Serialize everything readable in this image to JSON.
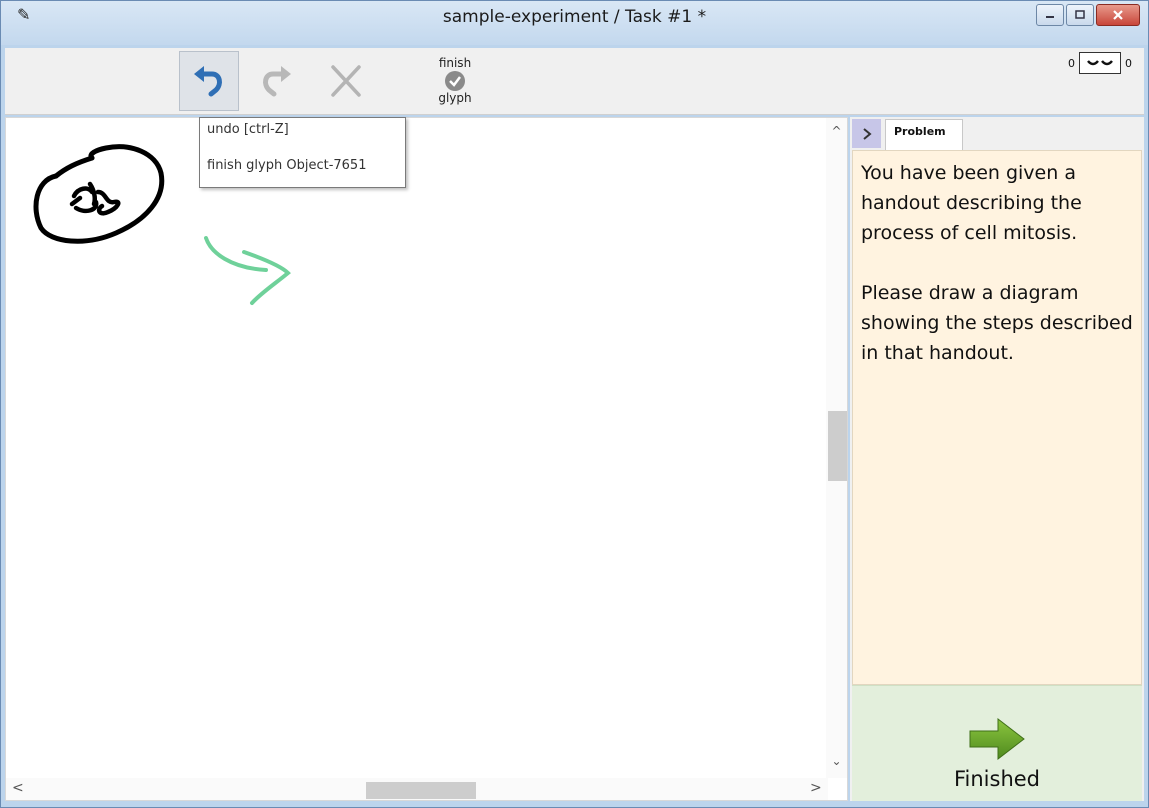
{
  "window": {
    "title": "sample-experiment / Task #1 *",
    "controls": [
      "minimize",
      "maximize",
      "close"
    ]
  },
  "toolbar": {
    "undo_icon": "undo-icon",
    "redo_icon": "redo-icon",
    "delete_icon": "x-icon",
    "finish_glyph_top": "finish",
    "finish_glyph_bottom": "glyph",
    "counter_left": "0",
    "counter_right": "0"
  },
  "tooltip": {
    "line1": "undo [ctrl-Z]",
    "line2": "finish glyph Object-7651"
  },
  "panel": {
    "collapse_icon": "chevron-right-icon",
    "tab_label": "Problem",
    "problem_paragraphs": [
      "You have been given a handout describing the process of cell mitosis.",
      "Please draw a diagram showing the steps described in that handout."
    ],
    "finished_label": "Finished"
  },
  "colors": {
    "ink_black": "#000000",
    "ink_green": "#6fd19a",
    "undo_blue": "#2f6fb5",
    "problem_bg": "#fff3e0",
    "finished_bg": "#e3efdc",
    "arrow_green": "#5e9e26"
  }
}
